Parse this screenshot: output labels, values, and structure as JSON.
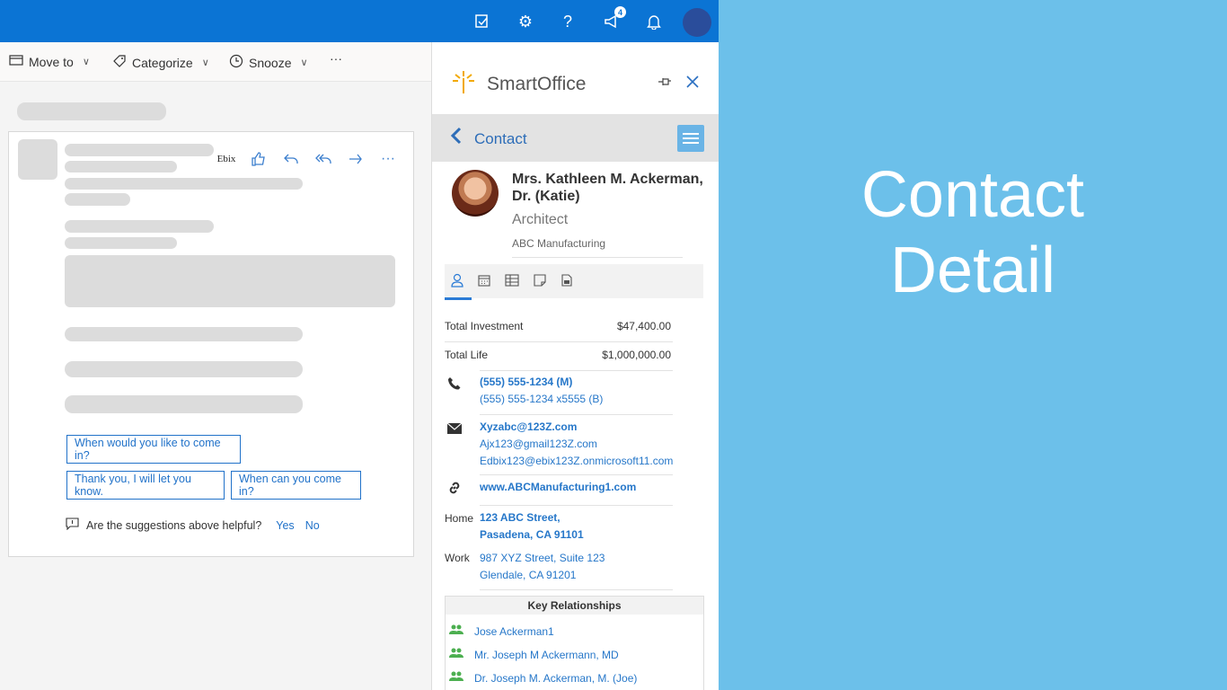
{
  "toolbar": {
    "move_to": "Move to",
    "categorize": "Categorize",
    "snooze": "Snooze",
    "more": "···"
  },
  "topbar": {
    "notification_count": "4"
  },
  "actions": {
    "ebix": "Ebix"
  },
  "suggestions": {
    "s1": "When would you like to come in?",
    "s2": "Thank you, I will let you know.",
    "s3": "When can you come in?",
    "helpful_q": "Are the suggestions above helpful?",
    "yes": "Yes",
    "no": "No"
  },
  "panel": {
    "brand": "SmartOffice",
    "nav_title": "Contact",
    "name": "Mrs. Kathleen M. Ackerman, Dr. (Katie)",
    "job_title": "Architect",
    "company": "ABC Manufacturing",
    "total_investment_label": "Total Investment",
    "total_investment_value": "$47,400.00",
    "total_life_label": "Total Life",
    "total_life_value": "$1,000,000.00",
    "phone_mobile": "(555) 555-1234 (M)",
    "phone_business": "(555) 555-1234 x5555 (B)",
    "email1": "Xyzabc@123Z.com",
    "email2": "Ajx123@gmail123Z.com",
    "email3": "Edbix123@ebix123Z.onmicrosoft11.com",
    "website": "www.ABCManufacturing1.com",
    "home_label": "Home",
    "home_line1": "123 ABC Street,",
    "home_line2": "Pasadena, CA 91101",
    "work_label": "Work",
    "work_line1": "987 XYZ Street, Suite 123",
    "work_line2": "Glendale, CA 91201",
    "key_relationships_title": "Key Relationships",
    "relationships": [
      "Jose Ackerman1",
      "Mr. Joseph M Ackermann, MD",
      "Dr. Joseph M. Ackerman, M. (Joe)"
    ]
  },
  "promo": {
    "line1": "Contact",
    "line2": "Detail"
  }
}
